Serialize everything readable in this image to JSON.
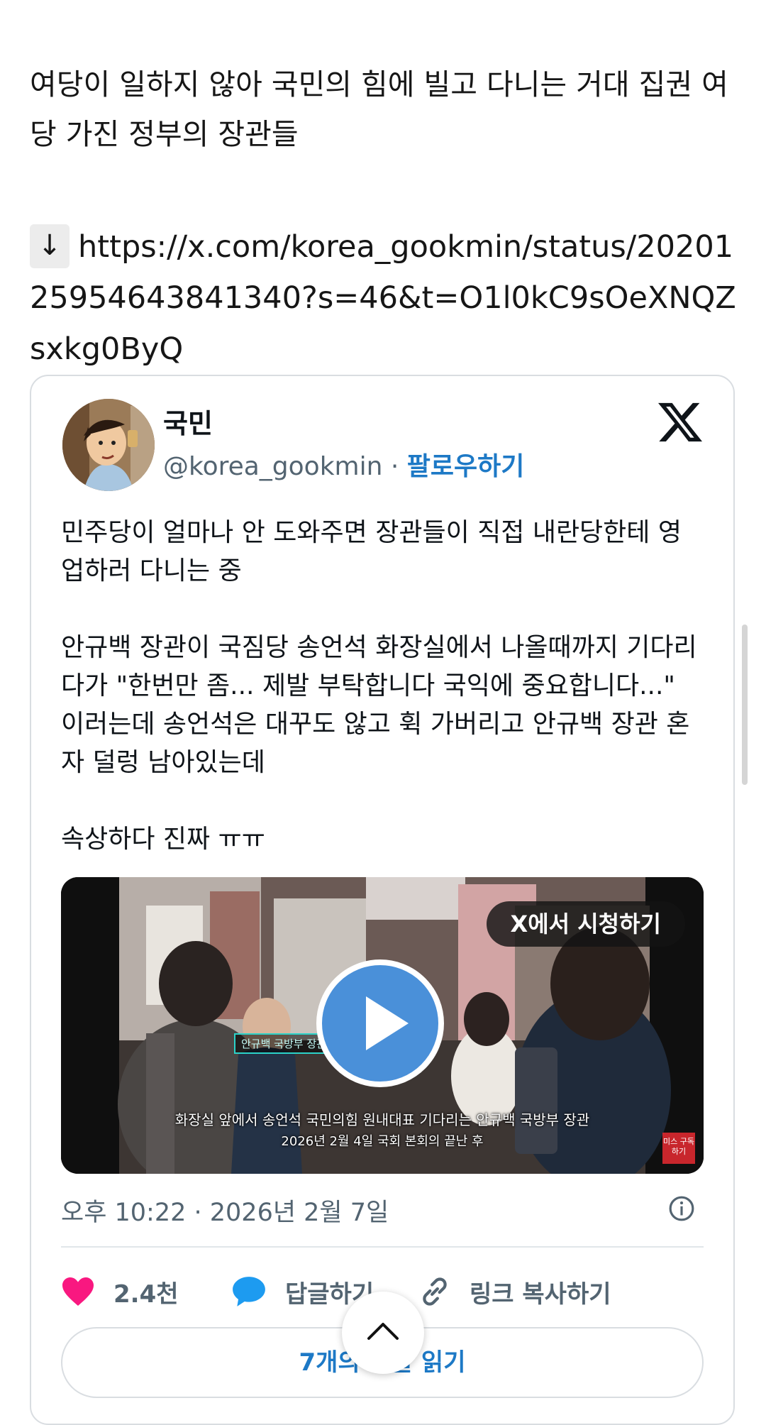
{
  "post": {
    "text": "여당이 일하지 않아 국민의 힘에 빌고 다니는 거대 집권 여당 가진 정부의 장관들",
    "arrow": "↓",
    "link": "https://x.com/korea_gookmin/status/2020125954643841340?s=46&t=O1l0kC9sOeXNQZsxkg0ByQ"
  },
  "tweet": {
    "author_name": "국민",
    "handle": "@korea_gookmin",
    "separator": " · ",
    "follow_label": "팔로우하기",
    "body": "민주당이 얼마나 안 도와주면 장관들이 직접 내란당한테 영업하러 다니는 중\n\n안규백 장관이 국짐당 송언석 화장실에서 나올때까지 기다리다가 \"한번만 좀... 제발 부탁합니다 국익에 중요합니다...\" 이러는데 송언석은 대꾸도 않고 휙 가버리고 안규백 장관 혼자 덜렁 남아있는데\n\n속상하다 진짜 ㅠㅠ",
    "media": {
      "watch_label": "X에서 시청하기",
      "name_tag": "안규백 국방부 장관",
      "caption_main": "화장실 앞에서 송언석 국민의힘 원내대표 기다리는 안규백 국방부 장관",
      "caption_sub": "2026년 2월 4일 국회 본회의 끝난 후",
      "channel_badge": "미스 구독하기"
    },
    "timestamp": "오후 10:22 · 2026년 2월 7일",
    "likes": "2.4천",
    "reply_label": "답글하기",
    "copy_link_label": "링크 복사하기",
    "read_replies_label": "7개의 답글 읽기"
  },
  "colors": {
    "link_blue": "#1d79c6",
    "like_pink": "#f91880",
    "reply_blue": "#1d9bf0",
    "muted": "#536471",
    "play_blue": "#4a90d9"
  }
}
